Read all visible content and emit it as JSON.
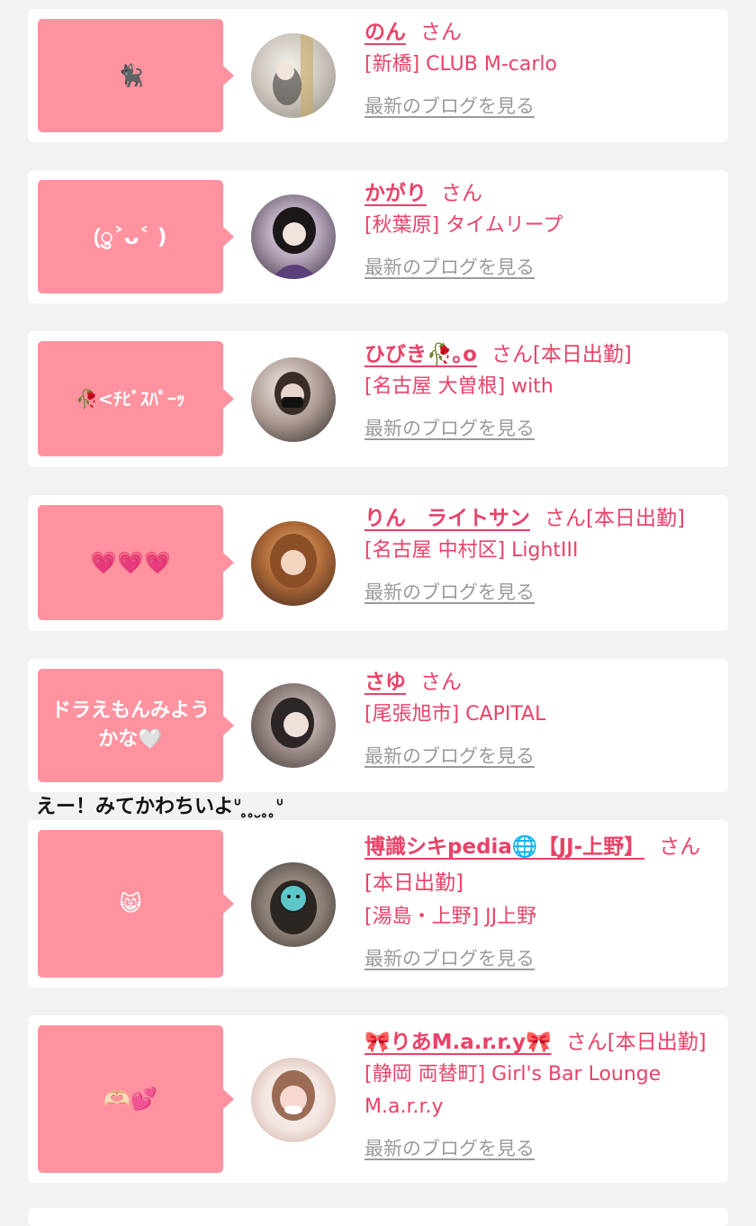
{
  "cards": [
    {
      "bubble": "🐈‍⬛",
      "name": "のん",
      "san": "さん",
      "shop": "[新橋] CLUB M-carlo",
      "blog_link": "最新のブログを見る",
      "avatar_colors": [
        "#e8e6e2",
        "#c7c1b8",
        "#8f8a84"
      ]
    },
    {
      "bubble": "(ु˃ᴗ˂ )",
      "name": "かがり",
      "san": "さん",
      "shop": "[秋葉原] タイムリープ",
      "blog_link": "最新のブログを見る",
      "avatar_colors": [
        "#cfc6d6",
        "#3a2e3f",
        "#5b3f7a"
      ]
    },
    {
      "bubble": "🥀<ﾁﾋﾞｽﾊﾟｰｯ",
      "name": "ひびき🥀｡o",
      "san": "さん[本日出勤]",
      "shop": "[名古屋 大曽根] with",
      "blog_link": "最新のブログを見る",
      "avatar_colors": [
        "#d9cfc9",
        "#7a6a63",
        "#2a2422"
      ]
    },
    {
      "bubble": "💗💗💗",
      "name": "りん　ライトサン",
      "san": "さん[本日出勤]",
      "shop": "[名古屋 中村区] LightIII",
      "blog_link": "最新のブログを見る",
      "avatar_colors": [
        "#3b2418",
        "#b06b3a",
        "#e3b07d"
      ]
    },
    {
      "bubble": "ドラえもんみようかな🤍",
      "name": "さゆ",
      "san": "さん",
      "shop": "[尾張旭市] CAPITAL",
      "blog_link": "最新のブログを見る",
      "avatar_colors": [
        "#6a5f5f",
        "#cbbcb8",
        "#3a3333"
      ]
    },
    {
      "bubble": "😸",
      "name": "博識シキpedia🌐【JJ-上野】",
      "san": "さん[本日出勤]",
      "shop": "[湯島・上野] JJ上野",
      "blog_link": "最新のブログを見る",
      "avatar_colors": [
        "#8a7e74",
        "#5cc6c9",
        "#3a3430"
      ]
    },
    {
      "bubble": "🫶🏻💕",
      "name": "🎀りあM.a.r.r.y🎀",
      "san": "さん[本日出勤]",
      "shop": "[静岡 両替町] Girl's Bar Lounge M.a.r.r.y",
      "blog_link": "最新のブログを見る",
      "avatar_colors": [
        "#f3e6e2",
        "#9c6b55",
        "#f6d8cf"
      ]
    }
  ],
  "banner": "えー！みてかわちいよᐡ ̥ ̥ ̮ ̥ ̥ᐡ"
}
